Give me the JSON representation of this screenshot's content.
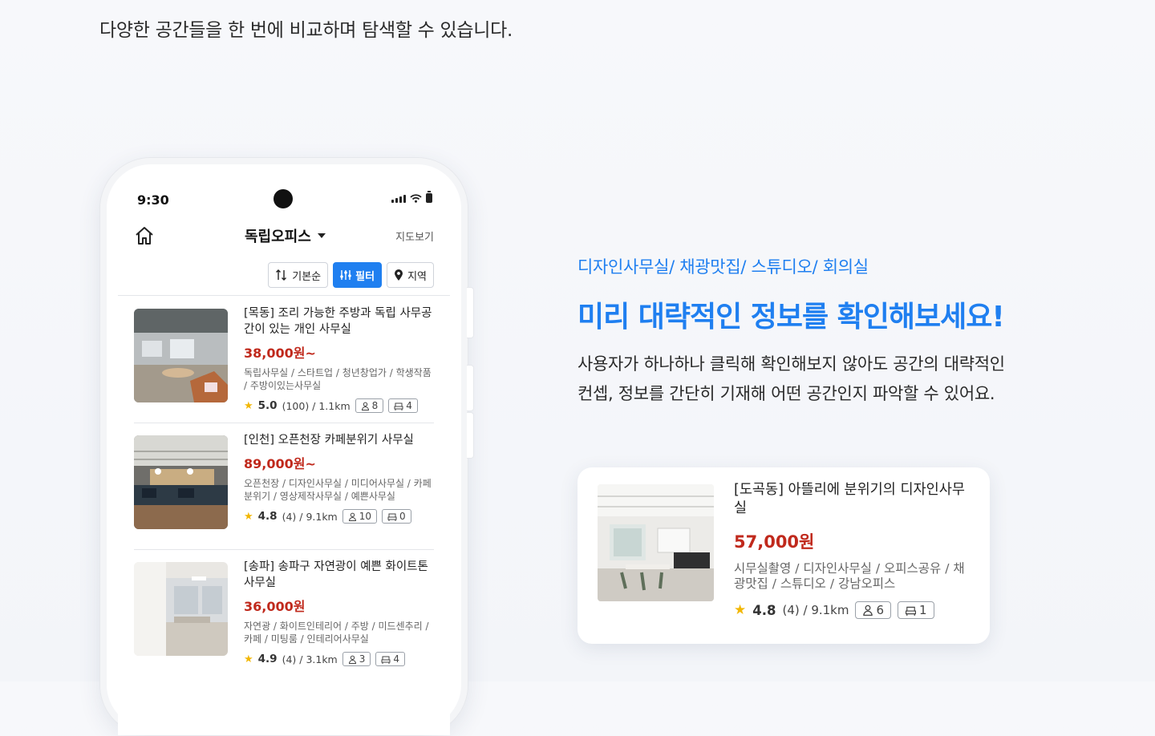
{
  "intro": {
    "text": "다양한 공간들을 한 번에 비교하며 탐색할 수 있습니다."
  },
  "phone": {
    "status_time": "9:30",
    "app_title": "독립오피스",
    "map_link": "지도보기",
    "filters": [
      {
        "label": "기본순",
        "icon": "sort-icon"
      },
      {
        "label": "필터",
        "icon": "filter-icon"
      },
      {
        "label": "지역",
        "icon": "location-pin-icon"
      }
    ],
    "listings": [
      {
        "title": "[목동] 조리 가능한 주방과 독립 사무공간이 있는 개인 사무실",
        "price": "38,000원~",
        "tags": "독립사무실 / 스타트업 / 청년창업가 / 학생작품 / 주방이있는사무실",
        "rating": "5.0",
        "meta": "(100) / 1.1km",
        "people": "8",
        "seats": "4"
      },
      {
        "title": "[인천] 오픈천장 카페분위기 사무실",
        "price": "89,000원~",
        "tags": "오픈천장 / 디자인사무실 / 미디어사무실 / 카페분위기 / 영상제작사무실 / 예쁜사무실",
        "rating": "4.8",
        "meta": "(4) / 9.1km",
        "people": "10",
        "seats": "0"
      },
      {
        "title": "[송파] 송파구 자연광이 예쁜 화이트톤 사무실",
        "price": "36,000원",
        "tags": "자연광 / 화이트인테리어 / 주방 / 미드센추리 / 카페 / 미팅룸 / 인테리어사무실",
        "rating": "4.9",
        "meta": "(4) / 3.1km",
        "people": "3",
        "seats": "4"
      }
    ]
  },
  "feature": {
    "categories": "디자인사무실/ 채광맛집/ 스튜디오/ 회의실",
    "headline": "미리 대략적인 정보를 확인해보세요!",
    "desc_line1": "사용자가 하나하나 클릭해 확인해보지 않아도 공간의 대략적인",
    "desc_line2": "컨셉, 정보를 간단히 기재해 어떤 공간인지 파악할 수 있어요."
  },
  "card": {
    "title": "[도곡동] 아뜰리에 분위기의 디자인사무실",
    "price": "57,000원",
    "tags": "시무실촬영 / 디자인사무실 / 오피스공유 / 채광맛집 / 스튜디오 / 강남오피스",
    "rating": "4.8",
    "meta": "(4) / 9.1km",
    "people": "6",
    "seats": "1"
  },
  "colors": {
    "accent": "#1f7ff0",
    "price": "#c0291c",
    "star": "#f2b705"
  }
}
